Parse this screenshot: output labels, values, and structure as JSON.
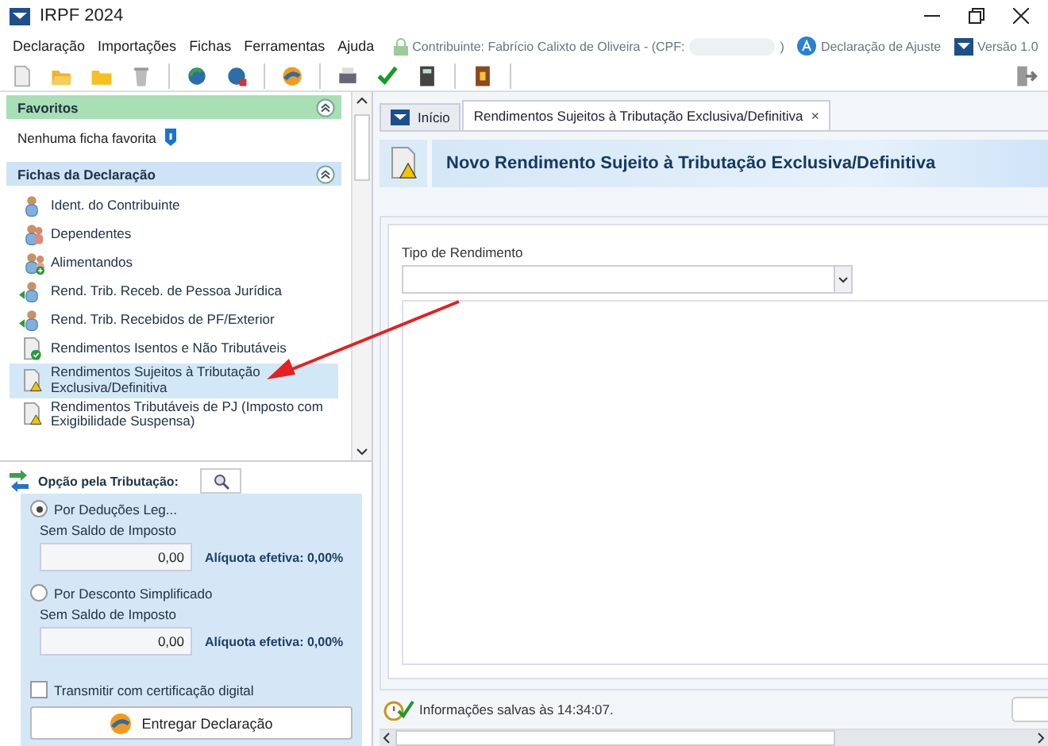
{
  "window": {
    "title": "IRPF 2024"
  },
  "menu": [
    "Declaração",
    "Importações",
    "Fichas",
    "Ferramentas",
    "Ajuda"
  ],
  "header_info": {
    "taxpayer": "Contribuinte: Fabrício Calixto de Oliveira - (CPF:",
    "taxpayer_end": ")",
    "mode": "Declaração de Ajuste",
    "version": "Versão 1.0"
  },
  "favorites": {
    "title": "Favoritos",
    "empty_text": "Nenhuma ficha favorita"
  },
  "fichas": {
    "title": "Fichas da Declaração",
    "items": [
      {
        "label": "Ident. do Contribuinte",
        "selected": false
      },
      {
        "label": "Dependentes",
        "selected": false
      },
      {
        "label": "Alimentandos",
        "selected": false
      },
      {
        "label": "Rend. Trib. Receb. de Pessoa Jurídica",
        "selected": false
      },
      {
        "label": "Rend. Trib. Recebidos de PF/Exterior",
        "selected": false
      },
      {
        "label": "Rendimentos Isentos e Não Tributáveis",
        "selected": false
      },
      {
        "label": "Rendimentos Sujeitos à Tributação Exclusiva/Definitiva",
        "selected": true
      },
      {
        "label": "Rendimentos Tributáveis de PJ (Imposto com Exigibilidade Suspensa)",
        "selected": false
      }
    ]
  },
  "tributacao": {
    "title": "Opção pela Tributação:",
    "options": [
      {
        "label": "Por Deduções Leg...",
        "selected": true,
        "caption": "Sem Saldo de Imposto",
        "value": "0,00",
        "rate": "Alíquota efetiva: 0,00%"
      },
      {
        "label": "Por Desconto Simplificado",
        "selected": false,
        "caption": "Sem Saldo de Imposto",
        "value": "0,00",
        "rate": "Alíquota efetiva: 0,00%"
      }
    ],
    "certificate": {
      "label": "Transmitir com certificação digital",
      "checked": false
    },
    "submit": "Entregar Declaração"
  },
  "tabs": [
    {
      "label": "Início",
      "selected": false
    },
    {
      "label": "Rendimentos Sujeitos à Tributação Exclusiva/Definitiva",
      "selected": true,
      "close": "×"
    }
  ],
  "form": {
    "title": "Novo Rendimento Sujeito à Tributação Exclusiva/Definitiva",
    "field_label": "Tipo de Rendimento"
  },
  "status": "Informações salvas às 14:34:07."
}
